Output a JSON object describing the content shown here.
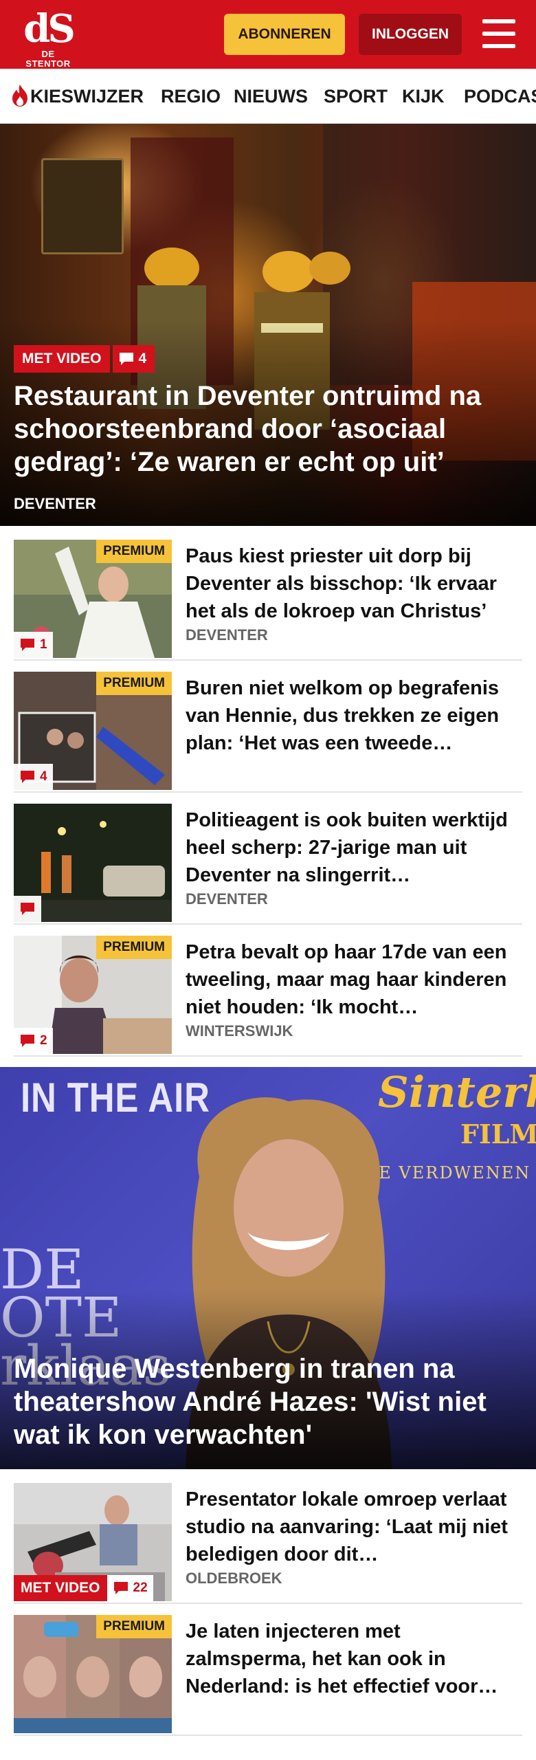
{
  "header": {
    "logo_mark": "dS",
    "logo_name": "DE STENTOR",
    "subscribe_label": "ABONNEREN",
    "login_label": "INLOGGEN",
    "colors": {
      "brand": "#d1121c",
      "subscribe": "#f5c23a",
      "login": "#a00d14"
    }
  },
  "nav": {
    "items": [
      {
        "label": "KIESWIJZER",
        "icon": "flame-icon"
      },
      {
        "label": "REGIO"
      },
      {
        "label": "NIEUWS"
      },
      {
        "label": "SPORT"
      },
      {
        "label": "KIJK"
      },
      {
        "label": "PODCAS"
      }
    ]
  },
  "hero": {
    "badge": "MET VIDEO",
    "comments": "4",
    "title": "Restaurant in Deventer ontruimd na schoorsteenbrand door ‘asociaal gedrag’: ‘Ze waren er echt op uit’",
    "category": "DEVENTER"
  },
  "articles": [
    {
      "title": "Paus kiest priester uit dorp bij Deventer als bisschop: ‘Ik ervaar het als de lokroep van Christus’",
      "category": "DEVENTER",
      "premium": "PREMIUM",
      "comments": "1"
    },
    {
      "title": "Buren niet welkom op begrafenis van Hennie, dus trekken ze eigen plan: ‘Het was een tweede…",
      "category": "",
      "premium": "PREMIUM",
      "comments": "4"
    },
    {
      "title": "Politieagent is ook buiten werktijd heel scherp: 27-jarige man uit Deventer na slingerrit…",
      "category": "DEVENTER",
      "premium": "",
      "comments": ""
    },
    {
      "title": "Petra bevalt op haar 17de van een tweeling, maar mag haar kinderen niet houden: ‘Ik mocht…",
      "category": "WINTERSWIJK",
      "premium": "PREMIUM",
      "comments": "2"
    }
  ],
  "feature": {
    "bg_text_1": "IN THE AIR",
    "bg_text_2": "Sinterk",
    "bg_text_3": "FILM",
    "bg_text_4": "DE VERDWENEN V",
    "bg_text_5": "DE\nOTE\nrklaas",
    "title": "Monique Westenberg in tranen na theatershow André Hazes: 'Wist niet wat ik kon verwachten'"
  },
  "articles2": [
    {
      "title": "Presentator lokale omroep verlaat studio na aanvaring: ‘Laat mij niet beledigen door dit…",
      "category": "OLDEBROEK",
      "badge": "MET VIDEO",
      "comments": "22"
    },
    {
      "title": "Je laten injecteren met zalmsperma, het kan ook in Nederland: is het effectief voor…",
      "category": "",
      "premium": "PREMIUM"
    }
  ]
}
